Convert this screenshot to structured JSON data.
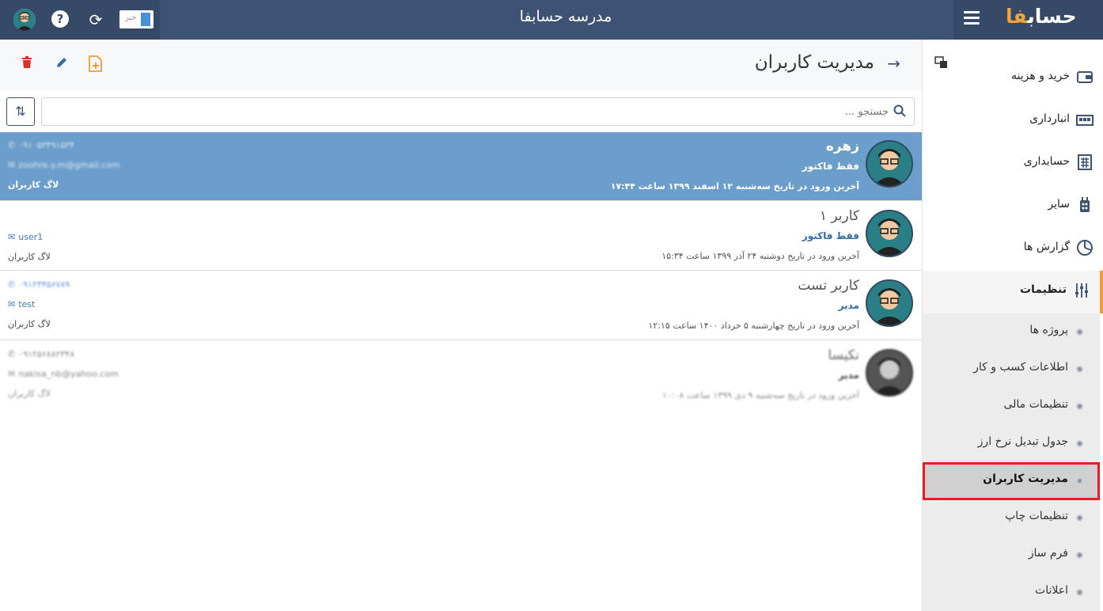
{
  "app": {
    "title": "مدرسه حسابفا",
    "logo_text": "حساب",
    "logo_accent": "فا",
    "lang_label": "خیر"
  },
  "header": {
    "page_title": "مدیریت کاربران"
  },
  "search": {
    "placeholder": "جستجو ..."
  },
  "sidebar": {
    "items": [
      {
        "label": "خرید و هزینه",
        "icon": "wallet-icon"
      },
      {
        "label": "انبارداری",
        "icon": "warehouse-icon"
      },
      {
        "label": "حسابداری",
        "icon": "calculator-icon"
      },
      {
        "label": "سایر",
        "icon": "other-icon"
      },
      {
        "label": "گزارش ها",
        "icon": "chart-pie-icon"
      },
      {
        "label": "تنظیمات",
        "icon": "sliders-icon"
      }
    ],
    "settings_sub": [
      {
        "label": "پروژه ها"
      },
      {
        "label": "اطلاعات کسب و کار"
      },
      {
        "label": "تنظیمات مالی"
      },
      {
        "label": "جدول تبدیل نرخ ارز"
      },
      {
        "label": "مدیریت کاربران"
      },
      {
        "label": "تنظیمات چاپ"
      },
      {
        "label": "فرم ساز"
      },
      {
        "label": "اعلانات"
      }
    ]
  },
  "users": [
    {
      "name": "زهره",
      "role": "فقط فاکتور",
      "last_login": "آخرین ورود در تاریخ سه‌شنبه ۱۲ اسفند ۱۳۹۹ ساعت ۱۷:۴۴",
      "phone": "۰۹۱۰۵۳۳۹۱۵۳۴",
      "email": "zoohre.y.m@gmail.com",
      "log": "لاگ کاربران"
    },
    {
      "name": "کاربر ۱",
      "role": "فقط فاکتور",
      "last_login": "آخرین ورود در تاریخ دوشنبه ۲۴ آذر ۱۳۹۹ ساعت ۱۵:۳۴",
      "phone": "",
      "email": "user1",
      "log": "لاگ کاربران"
    },
    {
      "name": "کاربر تست",
      "role": "مدیر",
      "last_login": "آخرین ورود در تاریخ چهارشنبه ۵ خرداد ۱۴۰۰ ساعت ۱۲:۱۵",
      "phone": "۰۹۱۲۳۴۵۶۷۸۹",
      "email": "test",
      "log": "لاگ کاربران"
    },
    {
      "name": "نکیسا",
      "role": "مدیر",
      "last_login": "آخرین ورود در تاریخ سه‌شنبه ۹ دی ۱۳۹۹ ساعت ۱۰:۰۸",
      "phone": "۰۹۱۲۵۶۸۸۲۳۴۸",
      "email": "nakisa_nb@yahoo.com",
      "log": "لاگ کاربران"
    }
  ],
  "colors": {
    "topbar": "#3e5373",
    "selected_row": "#6c9ecb",
    "accent_orange": "#f39a38",
    "highlight_red": "#e81d23"
  }
}
